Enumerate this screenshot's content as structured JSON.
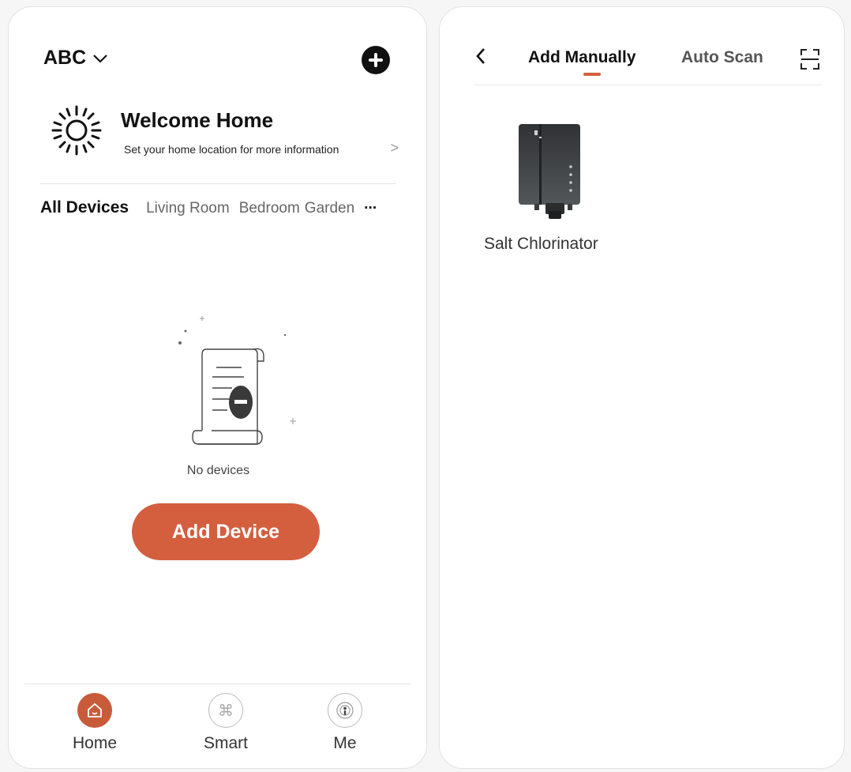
{
  "left_screen": {
    "home_name": "ABC",
    "welcome": {
      "title": "Welcome Home",
      "subtitle": "Set your home location for more information",
      "chevron": ">"
    },
    "tabs": [
      "All Devices",
      "Living Room",
      "Bedroom",
      "Garden"
    ],
    "tabs_more": "···",
    "empty_text": "No devices",
    "add_device_label": "Add Device",
    "nav": [
      {
        "label": "Home",
        "icon": "home-icon",
        "active": true
      },
      {
        "label": "Smart",
        "icon": "smart-icon"
      },
      {
        "label": "Me",
        "icon": "me-icon"
      }
    ],
    "accent_color": "#d35f3f"
  },
  "right_screen": {
    "tabs": [
      "Add Manually",
      "Auto Scan"
    ],
    "active_tab": "Add Manually",
    "devices": [
      {
        "name": "Salt Chlorinator",
        "icon": "salt-chlorinator-image"
      }
    ]
  }
}
